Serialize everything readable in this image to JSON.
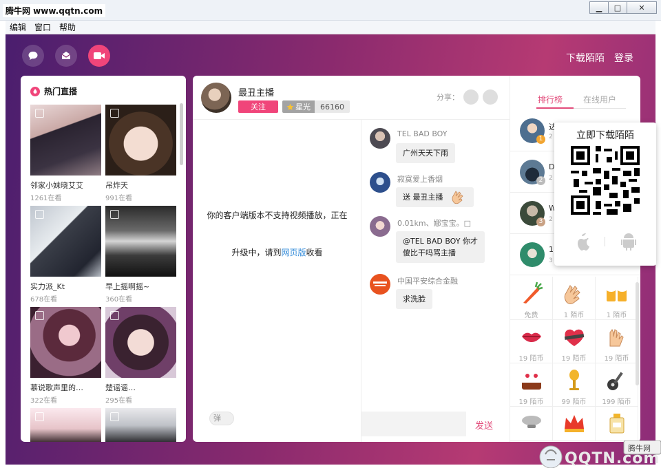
{
  "window": {
    "title": "腾牛网 www.qqtn.com",
    "btn_minimize": "▁",
    "btn_maximize": "□",
    "btn_close": "✕"
  },
  "menu": {
    "items": [
      "编辑",
      "窗口",
      "帮助"
    ]
  },
  "topnav": {
    "download_link": "下载陌陌",
    "login_link": "登录"
  },
  "hot_live": {
    "title": "热门直播",
    "cards": [
      {
        "name": "邻家小妹晓艾艾",
        "views": "1261在看"
      },
      {
        "name": "吊炸天",
        "views": "991在看"
      },
      {
        "name": "实力派_Kt",
        "views": "678在看"
      },
      {
        "name": "早上摇啊摇~",
        "views": "360在看"
      },
      {
        "name": "慕说歌声里的…",
        "views": "322在看"
      },
      {
        "name": "楚谣谣…",
        "views": "295在看"
      }
    ]
  },
  "host": {
    "name": "最丑主播",
    "follow_label": "关注",
    "star_label": "星光",
    "star_value": "66160",
    "share_label": "分享："
  },
  "video": {
    "unsupported_line1": "你的客户端版本不支持视频播放，正在",
    "unsupported_line2": "升级中，请到",
    "web_link": "网页版",
    "unsupported_line2_tail": "收看",
    "danmu_label": "弹"
  },
  "chat": {
    "messages": [
      {
        "user": "TEL BAD BOY",
        "text": "广州天天下雨"
      },
      {
        "user": "寂寞爱上香烟",
        "text": "送 最丑主播"
      },
      {
        "user": "0.01km、娜宝宝。□",
        "text": "@TEL BAD BOY 你才",
        "text2": "傻比干吗骂主播"
      },
      {
        "user": "中国平安综合金融",
        "text": "求洗脸"
      }
    ],
    "send_label": "发送"
  },
  "right": {
    "tab_rank": "排行榜",
    "tab_online": "在线用户",
    "ranks": [
      {
        "num": "1",
        "name": "达",
        "sub": "2"
      },
      {
        "num": "2",
        "name": "D",
        "sub": "2"
      },
      {
        "num": "3",
        "name": "W",
        "sub": "2"
      },
      {
        "num": "",
        "name": "1",
        "sub": "3"
      }
    ],
    "gifts": [
      {
        "name": "carrot-gift-icon",
        "price": "免费"
      },
      {
        "name": "clap-gift-icon",
        "price": "1 陌币"
      },
      {
        "name": "beer-gift-icon",
        "price": "1 陌币"
      },
      {
        "name": "lips-gift-icon",
        "price": "19 陌币"
      },
      {
        "name": "heart-gift-icon",
        "price": "19 陌币"
      },
      {
        "name": "hands-gift-icon",
        "price": "19 陌币"
      },
      {
        "name": "cake-gift-icon",
        "price": "19 陌币"
      },
      {
        "name": "mic-gift-icon",
        "price": "99 陌币"
      },
      {
        "name": "guitar-gift-icon",
        "price": "199 陌币"
      },
      {
        "name": "airship-gift-icon",
        "price": ""
      },
      {
        "name": "crown-gift-icon",
        "price": ""
      },
      {
        "name": "perfume-gift-icon",
        "price": ""
      }
    ]
  },
  "download_popup": {
    "title": "立即下载陌陌"
  },
  "watermark": {
    "badge": "腾牛网",
    "text": "QQTN.com"
  },
  "colors": {
    "accent": "#f0457a",
    "link": "#2e88d8",
    "send": "#e24b7a"
  }
}
